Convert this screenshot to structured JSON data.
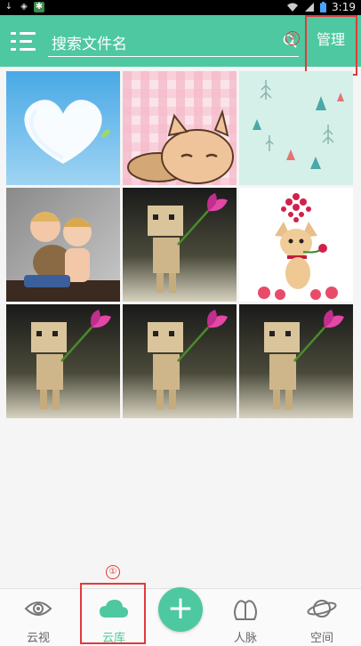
{
  "status_bar": {
    "icons": [
      "download-icon",
      "shield-icon",
      "app-icon",
      "wifi-icon",
      "signal-icon",
      "battery-icon"
    ],
    "time": "3:19"
  },
  "header": {
    "search_placeholder": "搜索文件名",
    "manage_label": "管理",
    "background_color": "#4ec8a0"
  },
  "annotations": {
    "manage_marker": "②",
    "tab_marker": "①"
  },
  "gallery": {
    "items": [
      {
        "name": "heart-cloud-photo"
      },
      {
        "name": "cartoon-cat-photo"
      },
      {
        "name": "mint-pattern-photo"
      },
      {
        "name": "kids-photo"
      },
      {
        "name": "danbo-flower-photo"
      },
      {
        "name": "chihuahua-photo"
      },
      {
        "name": "danbo-flower-photo"
      },
      {
        "name": "danbo-flower-photo"
      },
      {
        "name": "danbo-flower-photo"
      }
    ]
  },
  "bottom_nav": {
    "tabs": [
      {
        "label": "云视",
        "icon": "eye-icon",
        "active": false
      },
      {
        "label": "云库",
        "icon": "cloud-icon",
        "active": true
      },
      {
        "label": "人脉",
        "icon": "people-icon",
        "active": false
      },
      {
        "label": "空间",
        "icon": "planet-icon",
        "active": false
      }
    ],
    "add_label": "+"
  }
}
